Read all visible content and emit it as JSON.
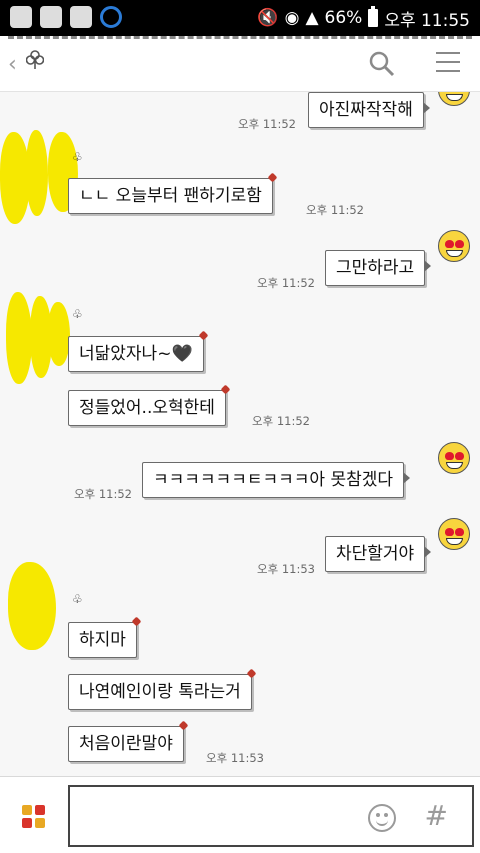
{
  "status_bar": {
    "battery": "66%",
    "time": "오후 11:55"
  },
  "header": {
    "back_glyph": "‹",
    "search_label": "search",
    "menu_label": "menu"
  },
  "messages": [
    {
      "side": "out",
      "text": "아진짜작작해",
      "time": "오후 11:52"
    },
    {
      "side": "in",
      "text": "ㄴㄴ 오늘부터 팬하기로함",
      "time": "오후 11:52"
    },
    {
      "side": "out",
      "text": "그만하라고",
      "time": "오후 11:52"
    },
    {
      "side": "in",
      "text": "너닮았자나~🖤",
      "time": ""
    },
    {
      "side": "in",
      "text": "정들었어..오혁한테",
      "time": "오후 11:52"
    },
    {
      "side": "out",
      "text": "ㅋㅋㅋㅋㅋㅋㅌㅋㅋㅋ아 못참겠다",
      "time": "오후 11:52"
    },
    {
      "side": "out",
      "text": "차단할거야",
      "time": "오후 11:53"
    },
    {
      "side": "in",
      "text": "하지마",
      "time": ""
    },
    {
      "side": "in",
      "text": "나연예인이랑 톡라는거",
      "time": ""
    },
    {
      "side": "in",
      "text": "처음이란말야",
      "time": "오후 11:53"
    }
  ],
  "colors": {
    "accent_red": "#c0392b",
    "emoji_yellow": "#f8d53e",
    "redact_yellow": "#f6e800"
  },
  "input": {
    "emoji_icon": "smile-icon",
    "hash_glyph": "#"
  }
}
